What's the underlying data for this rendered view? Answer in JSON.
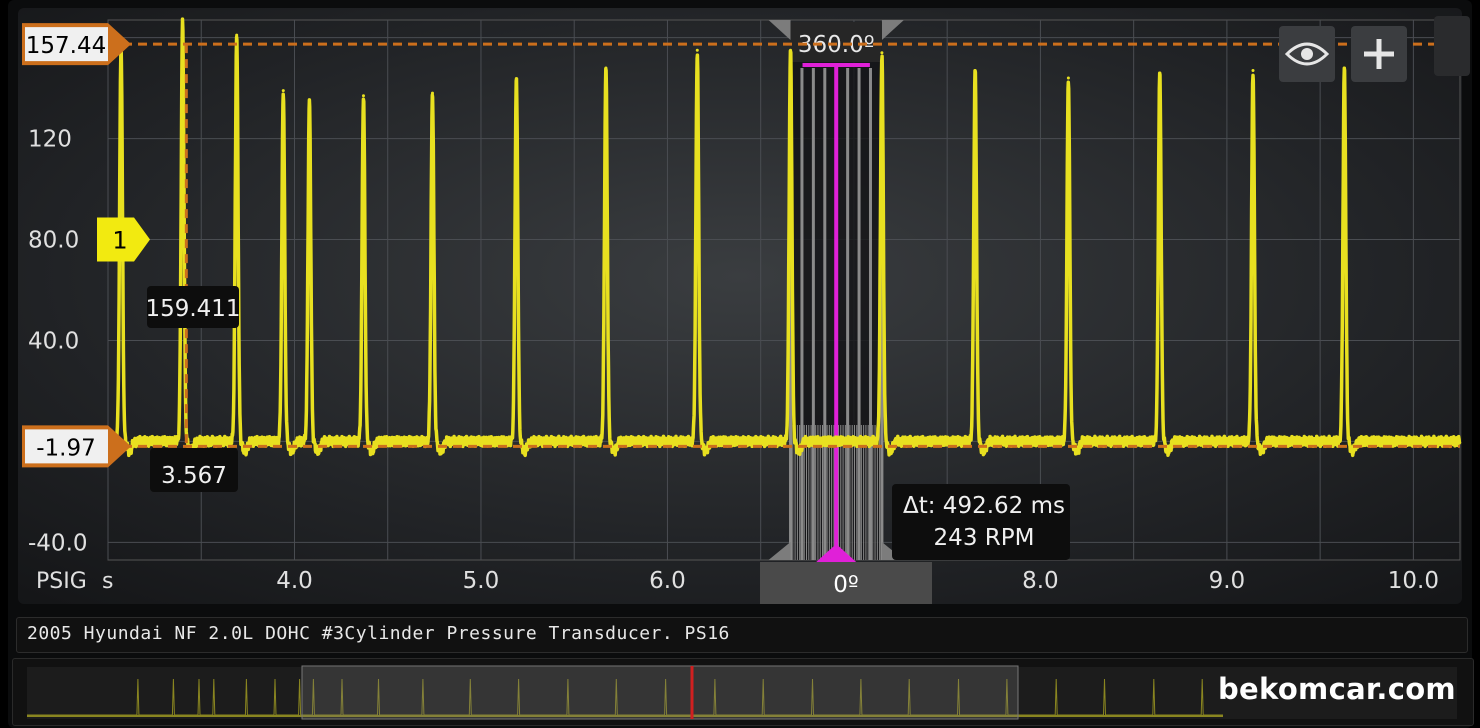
{
  "chart_data": {
    "type": "line",
    "title": "",
    "xlabel": "s",
    "ylabel": "PSIG",
    "xlim": [
      3.0,
      10.25
    ],
    "ylim": [
      -47,
      167
    ],
    "x_ticks": [
      "4.0",
      "5.0",
      "6.0",
      "8.0",
      "9.0",
      "10.0"
    ],
    "y_ticks": [
      "120",
      "80.0",
      "40.0",
      "-40.0"
    ],
    "y_tick_partial": [
      "160"
    ],
    "series": [
      {
        "color": "#e8e020",
        "baseline": 0,
        "peaks": [
          {
            "x": 3.07,
            "y": 157
          },
          {
            "x": 3.4,
            "y": 166
          },
          {
            "x": 3.69,
            "y": 161
          },
          {
            "x": 3.94,
            "y": 139
          },
          {
            "x": 4.08,
            "y": 135
          },
          {
            "x": 4.37,
            "y": 137
          },
          {
            "x": 4.74,
            "y": 138
          },
          {
            "x": 5.19,
            "y": 143
          },
          {
            "x": 5.67,
            "y": 148
          },
          {
            "x": 6.16,
            "y": 155
          },
          {
            "x": 6.66,
            "y": 155
          },
          {
            "x": 7.15,
            "y": 154
          },
          {
            "x": 7.65,
            "y": 147
          },
          {
            "x": 8.15,
            "y": 144
          },
          {
            "x": 8.64,
            "y": 146
          },
          {
            "x": 9.14,
            "y": 147
          },
          {
            "x": 9.63,
            "y": 148
          }
        ]
      }
    ],
    "h_cursors": [
      {
        "label": "157.44",
        "y": 157.44,
        "color": "#cc6f1c"
      },
      {
        "label": "-1.97",
        "y": -1.97,
        "color": "#cc6f1c"
      }
    ],
    "v_cursor": {
      "x": 3.42,
      "color": "#cc6f1c"
    },
    "channel_marker": {
      "label": "1",
      "y": 80,
      "color": "#f2ea10"
    },
    "readouts": {
      "upper": "159.411",
      "lower": "3.567"
    },
    "degree_ruler": {
      "top_label": "360.0º",
      "bottom_label": "0º",
      "color": "#e020d8",
      "x_start": 6.66,
      "x_end": 7.15
    },
    "delta_readout": {
      "line1": "Δt: 492.62 ms",
      "line2": "243 RPM"
    },
    "grid": true
  },
  "ui": {
    "eye_icon": "eye-icon",
    "plus_icon": "plus-icon",
    "description": "2005 Hyundai NF 2.0L DOHC #3Cylinder Pressure Transducer. PS16",
    "watermark": "bekomcar.com"
  }
}
